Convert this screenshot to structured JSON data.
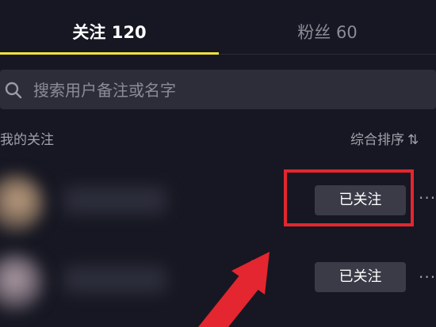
{
  "tabs": {
    "following": {
      "label": "关注 120"
    },
    "fans": {
      "label": "粉丝 60"
    }
  },
  "search": {
    "placeholder": "搜索用户备注或名字",
    "value": ""
  },
  "list": {
    "title": "我的关注",
    "sort_label": "综合排序",
    "items": [
      {
        "follow_label": "已关注"
      },
      {
        "follow_label": "已关注"
      }
    ]
  },
  "icons": {
    "search": "search-icon",
    "sort": "sort-icon",
    "more": "more-icon"
  },
  "colors": {
    "background": "#161722",
    "tab_indicator": "#f2e23c",
    "highlight": "#e3262f",
    "button": "#3a3b47"
  }
}
